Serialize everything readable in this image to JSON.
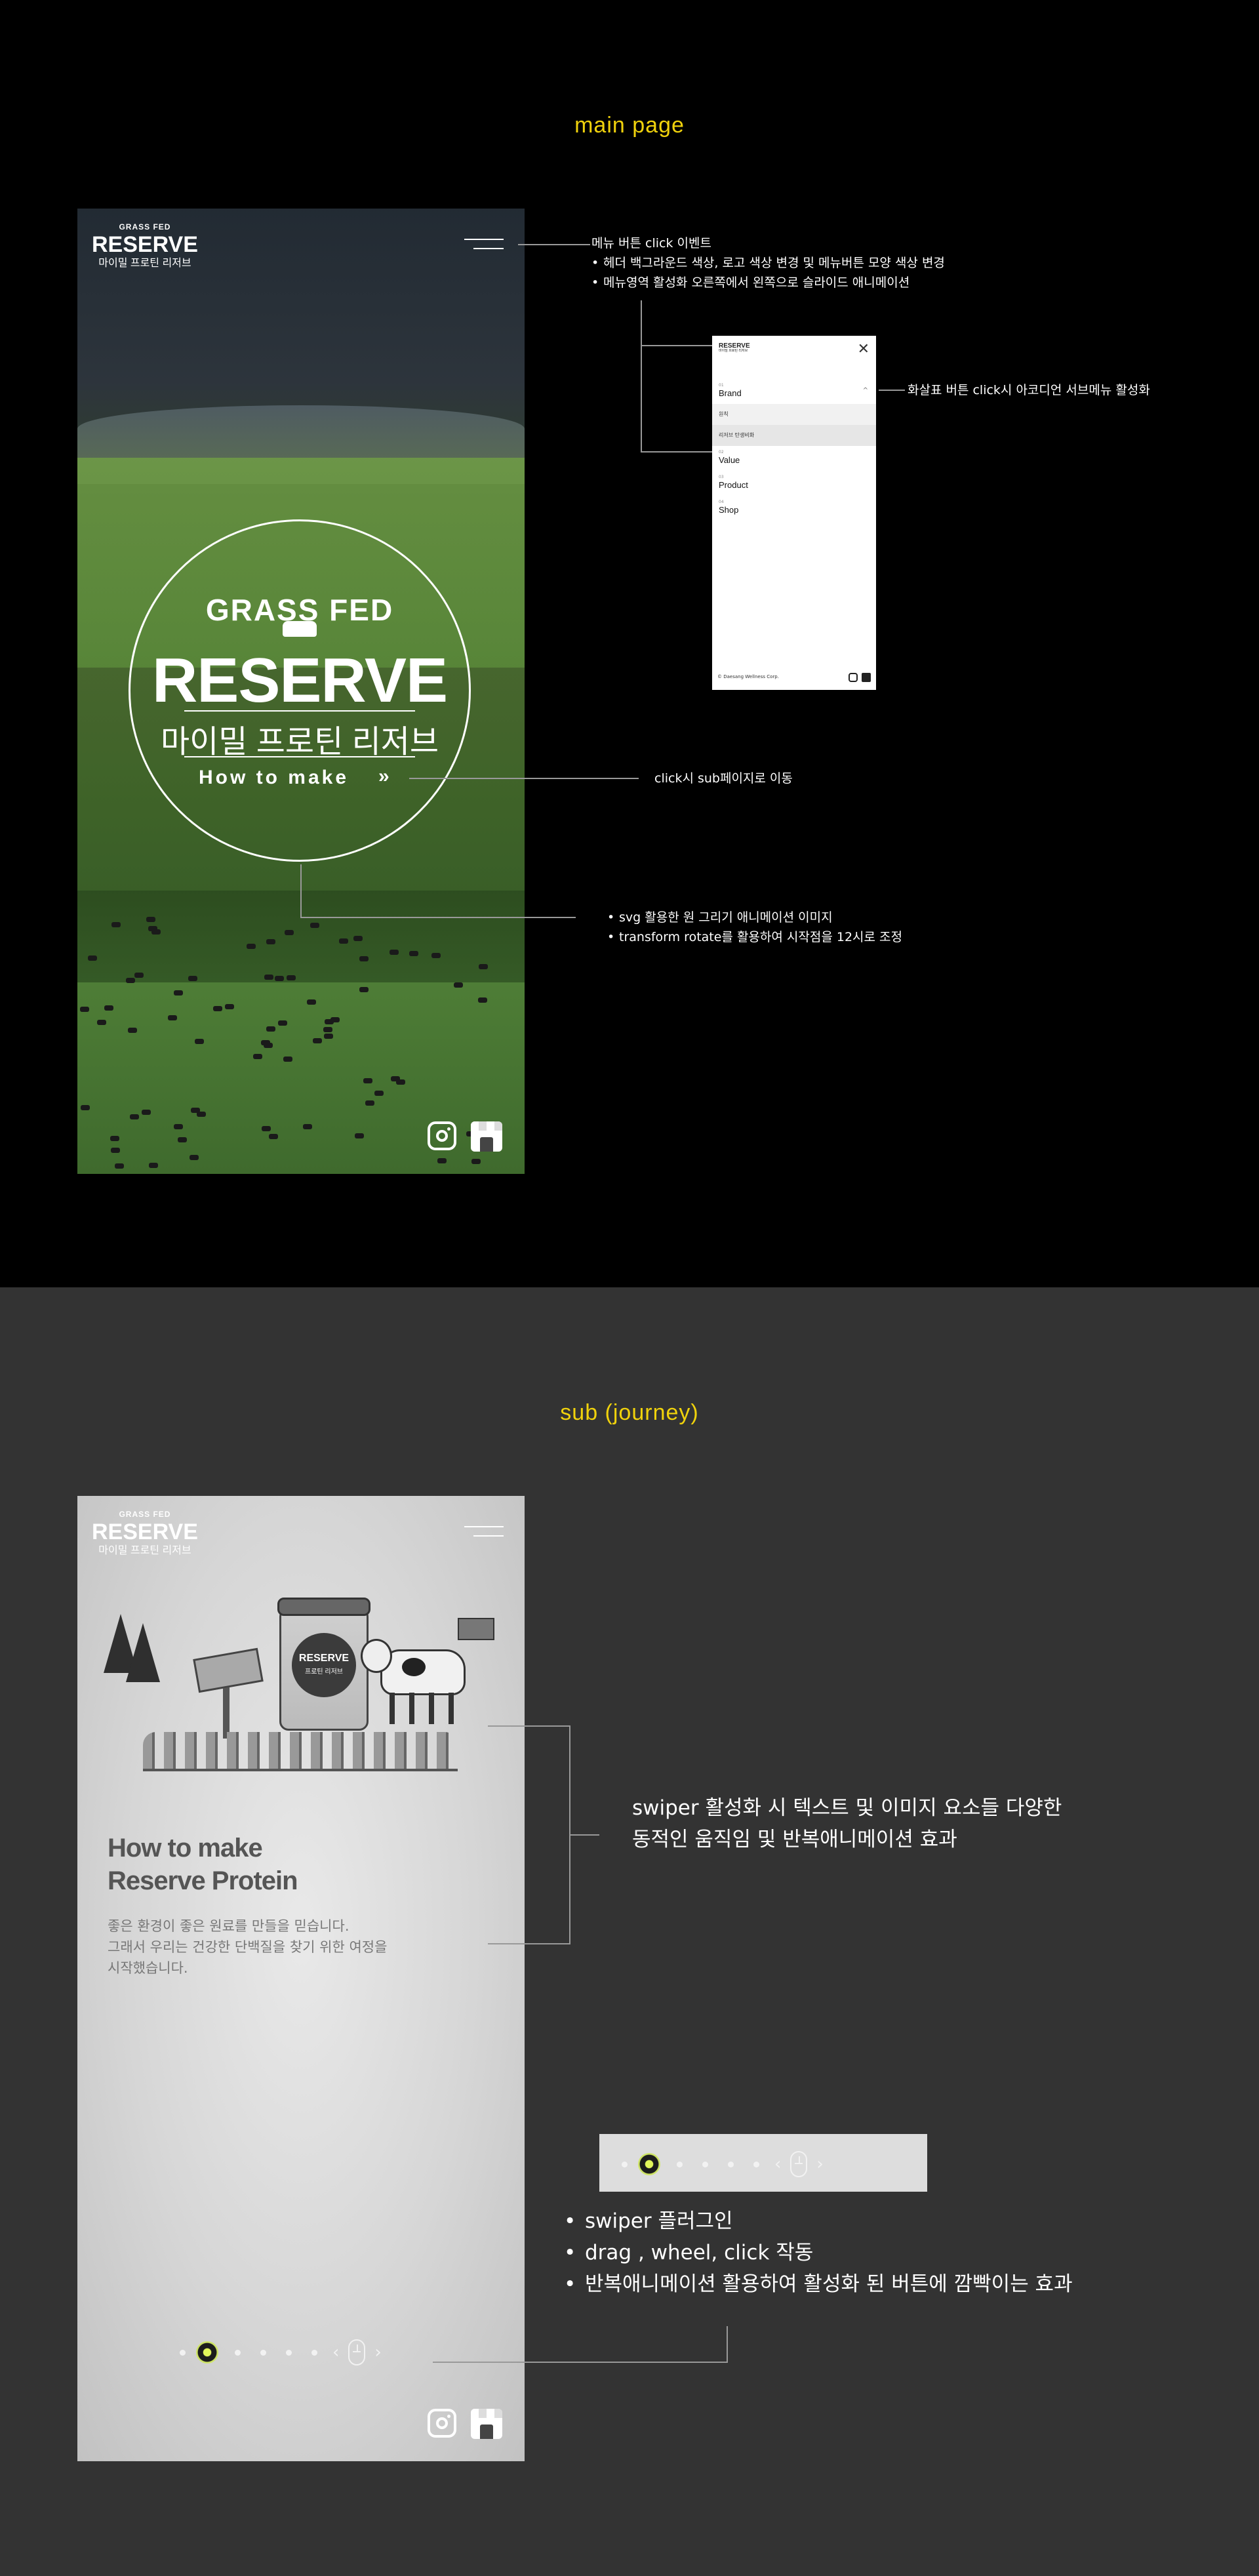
{
  "main_section": {
    "title": "main page",
    "logo": {
      "top": "GRASS FED",
      "main": "RESERVE",
      "korean": "마이밀 프로틴 리저브"
    },
    "circle": {
      "top": "GRASS FED",
      "main": "RESERVE",
      "korean": "마이밀 프로틴 리저브",
      "cta": "How to make",
      "cta_arrow": "»"
    },
    "annotations": {
      "menu_title": "메뉴 버튼 click 이벤트",
      "menu_points": [
        "헤더 백그라운드 색상, 로고 색상 변경 및 메뉴버튼 모양 색상 변경",
        "메뉴영역 활성화 오른쪽에서 왼쪽으로 슬라이드 애니메이션"
      ],
      "accordion": "화살표 버튼 click시 아코디언 서브메뉴 활성화",
      "cta_click": "click시 sub페이지로 이동",
      "svg_points": [
        "svg 활용한 원 그리기 애니메이션 이미지",
        "transform rotate를 활용하여 시작점을 12시로 조정"
      ]
    },
    "menu_mock": {
      "logo_main": "RESERVE",
      "logo_kor": "마이밀 프로틴 리저브",
      "close_icon": "✕",
      "items": [
        {
          "num": "01",
          "label": "Brand"
        },
        {
          "num": "02",
          "label": "Value"
        },
        {
          "num": "03",
          "label": "Product"
        },
        {
          "num": "04",
          "label": "Shop"
        }
      ],
      "caret": "^",
      "sub_items": [
        "원칙",
        "리저브 탄생비화"
      ],
      "footer": "© Daesang Wellness Corp."
    },
    "social": {
      "instagram_icon": "instagram-icon",
      "store_icon": "store-icon"
    }
  },
  "sub_section": {
    "title": "sub (journey)",
    "logo": {
      "top": "GRASS FED",
      "main": "RESERVE",
      "korean": "마이밀 프로틴 리저브"
    },
    "jar_label": {
      "main": "RESERVE",
      "kor": "프로틴 리저브"
    },
    "heading_line1": "How to make",
    "heading_line2": "Reserve Protein",
    "desc_line1": "좋은 환경이 좋은 원료를 만들을 믿습니다.",
    "desc_line2": "그래서 우리는 건강한 단백질을 찾기 위한 여정을",
    "desc_line3": "시작했습니다.",
    "pager": {
      "prev": "‹",
      "next": "›"
    },
    "annotations": {
      "swiper_line1": "swiper 활성화 시 텍스트 및 이미지 요소들 다양한",
      "swiper_line2": "동적인 움직임 및 반복애니메이션 효과",
      "plugin_points": [
        "swiper 플러그인",
        "drag , wheel, click 작동",
        "반복애니메이션 활용하여 활성화 된 버튼에 깜빡이는 효과"
      ]
    }
  },
  "colors": {
    "accent_yellow": "#f0d20c",
    "sub_bg": "#333333",
    "main_bg": "#000000",
    "pager_active": "#e1f55a"
  }
}
